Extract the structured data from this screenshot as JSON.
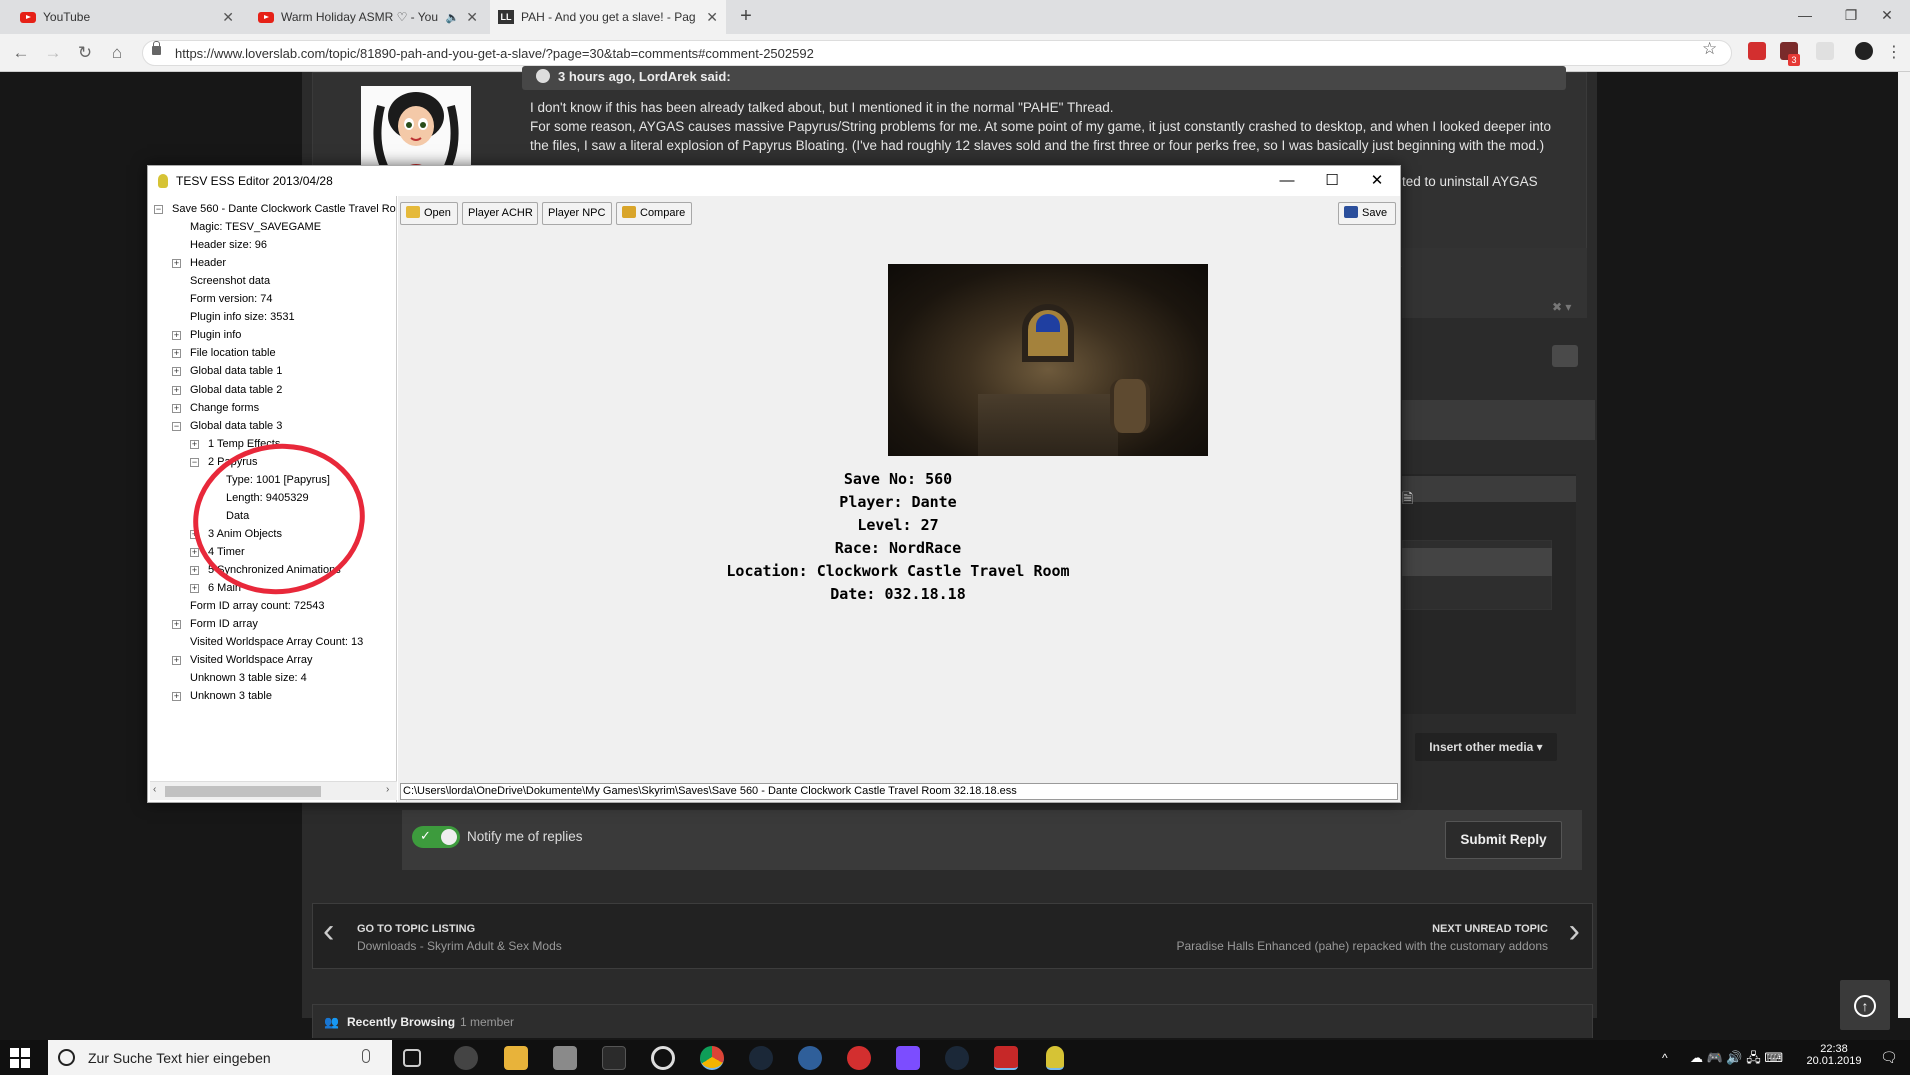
{
  "browser": {
    "tabs": [
      {
        "title": "YouTube",
        "icon": "youtube-icon"
      },
      {
        "title": "Warm Holiday ASMR ♡ - You",
        "icon": "youtube-icon",
        "audio": "🔈"
      },
      {
        "title": "PAH - And you get a slave! - Pag",
        "icon": "loverslab-icon",
        "icon_text": "LL"
      }
    ],
    "new_tab": "+",
    "url": "https://www.loverslab.com/topic/81890-pah-and-you-get-a-slave/?page=30&tab=comments#comment-2502592",
    "extension_badge": "3"
  },
  "post": {
    "quote_header": "3 hours ago, LordArek said:",
    "quote_lines": [
      "I don't know if this has been already talked about, but I mentioned it in the normal \"PAHE\" Thread.",
      "For some reason, AYGAS causes massive Papyrus/String problems for me. At some point of my game, it just constantly crashed to desktop, and when I looked deeper into the files, I saw a literal explosion of Papyrus Bloating. (I've had roughly 12 slaves sold and the first three or four perks free, so I was basically just beginning with the mod.)"
    ],
    "quote_tail": "ted to uninstall AYGAS"
  },
  "reply": {
    "insert_media": "Insert other media ▾",
    "notify": "Notify me of replies",
    "submit": "Submit Reply"
  },
  "topic_nav": {
    "prev_label": "GO TO TOPIC LISTING",
    "prev_sub": "Downloads - Skyrim Adult & Sex Mods",
    "next_label": "NEXT UNREAD TOPIC",
    "next_sub": "Paradise Halls Enhanced (pahe) repacked with the customary addons"
  },
  "recent": {
    "title": "Recently Browsing",
    "count": "1 member"
  },
  "tesv": {
    "title": "TESV ESS Editor 2013/04/28",
    "buttons": {
      "open": "Open",
      "achr": "Player ACHR",
      "npc": "Player NPC",
      "compare": "Compare",
      "save": "Save"
    },
    "tree": [
      {
        "label": "Save 560 - Dante  Clockwork Castle Travel Ro",
        "exp": "−",
        "level": 0
      },
      {
        "label": "Magic: TESV_SAVEGAME",
        "exp": "",
        "level": 1
      },
      {
        "label": "Header size: 96",
        "exp": "",
        "level": 1
      },
      {
        "label": "Header",
        "exp": "+",
        "level": 1
      },
      {
        "label": "Screenshot data",
        "exp": "",
        "level": 1
      },
      {
        "label": "Form version: 74",
        "exp": "",
        "level": 1
      },
      {
        "label": "Plugin info size: 3531",
        "exp": "",
        "level": 1
      },
      {
        "label": "Plugin info",
        "exp": "+",
        "level": 1
      },
      {
        "label": "File location table",
        "exp": "+",
        "level": 1
      },
      {
        "label": "Global data table 1",
        "exp": "+",
        "level": 1
      },
      {
        "label": "Global data table 2",
        "exp": "+",
        "level": 1
      },
      {
        "label": "Change forms",
        "exp": "+",
        "level": 1
      },
      {
        "label": "Global data table 3",
        "exp": "−",
        "level": 1
      },
      {
        "label": "1 Temp Effects",
        "exp": "+",
        "level": 2
      },
      {
        "label": "2 Papyrus",
        "exp": "−",
        "level": 2
      },
      {
        "label": "Type: 1001 [Papyrus]",
        "exp": "",
        "level": 3
      },
      {
        "label": "Length: 9405329",
        "exp": "",
        "level": 3
      },
      {
        "label": "Data",
        "exp": "",
        "level": 3
      },
      {
        "label": "3 Anim Objects",
        "exp": "+",
        "level": 2
      },
      {
        "label": "4 Timer",
        "exp": "+",
        "level": 2
      },
      {
        "label": "5 Synchronized Animations",
        "exp": "+",
        "level": 2
      },
      {
        "label": "6 Main",
        "exp": "+",
        "level": 2
      },
      {
        "label": "Form ID array count: 72543",
        "exp": "",
        "level": 1
      },
      {
        "label": "Form ID array",
        "exp": "+",
        "level": 1
      },
      {
        "label": "Visited Worldspace Array Count: 13",
        "exp": "",
        "level": 1
      },
      {
        "label": "Visited Worldspace Array",
        "exp": "+",
        "level": 1
      },
      {
        "label": "Unknown 3 table size: 4",
        "exp": "",
        "level": 1
      },
      {
        "label": "Unknown 3 table",
        "exp": "+",
        "level": 1
      }
    ],
    "info_lines": [
      "Save No: 560",
      "Player: Dante",
      "Level: 27",
      "Race: NordRace",
      "Location: Clockwork Castle Travel Room",
      "Date: 032.18.18"
    ],
    "path": "C:\\Users\\lorda\\OneDrive\\Dokumente\\My Games\\Skyrim\\Saves\\Save 560 - Dante  Clockwork Castle Travel Room  32.18.18.ess"
  },
  "taskbar": {
    "search_placeholder": "Zur Suche Text hier eingeben",
    "time": "22:38",
    "date": "20.01.2019"
  },
  "colors": {
    "accent_green": "#3d9b3d",
    "annotation_red": "#e8283a",
    "youtube_red": "#e62117"
  }
}
